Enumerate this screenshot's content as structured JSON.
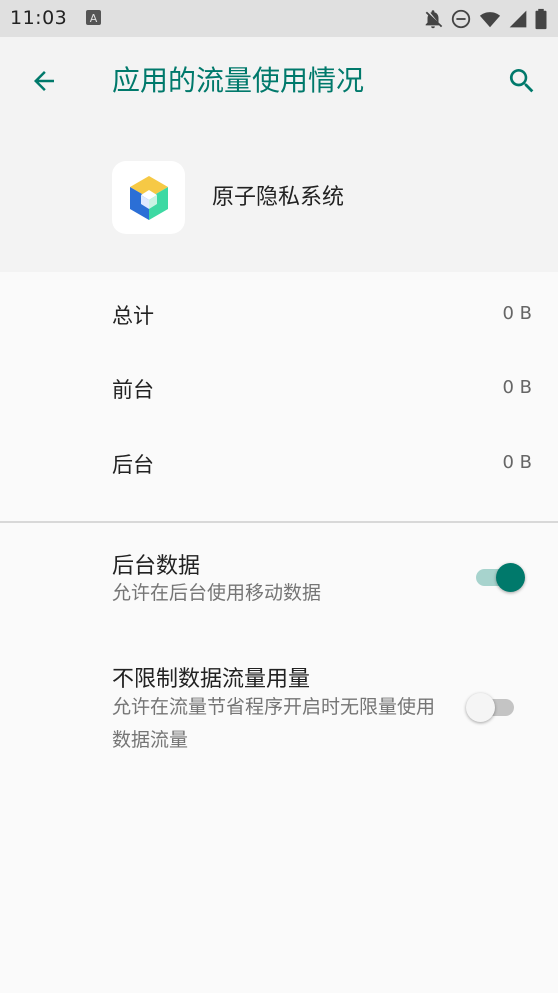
{
  "status_bar": {
    "time": "11:03",
    "icons": [
      "notification-a-icon",
      "notifications-off-icon",
      "do-not-disturb-icon",
      "wifi-icon",
      "cellular-icon",
      "battery-icon"
    ]
  },
  "toolbar": {
    "title": "应用的流量使用情况",
    "back_icon": "arrow-back-icon",
    "search_icon": "search-icon"
  },
  "app": {
    "name": "原子隐私系统",
    "icon": "app-cube-icon"
  },
  "usage": [
    {
      "label": "总计",
      "value": "0 B"
    },
    {
      "label": "前台",
      "value": "0 B"
    },
    {
      "label": "后台",
      "value": "0 B"
    }
  ],
  "settings": [
    {
      "title": "后台数据",
      "summary": "允许在后台使用移动数据",
      "enabled": true
    },
    {
      "title": "不限制数据流量用量",
      "summary": "允许在流量节省程序开启时无限量使用数据流量",
      "enabled": false
    }
  ],
  "colors": {
    "accent": "#00796b",
    "header_bg": "#f3f3f3",
    "status_bar_bg": "#e0e0e0",
    "page_bg": "#fafafa"
  }
}
